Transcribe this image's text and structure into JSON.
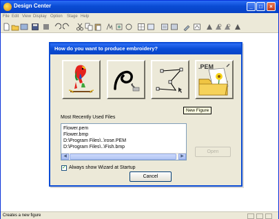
{
  "window": {
    "title": "Design Center",
    "controls": {
      "minimize": "_",
      "maximize": "□",
      "close": "×"
    }
  },
  "menubar": {
    "items": [
      "File",
      "Edit",
      "View",
      "Display",
      "Option",
      "Stage",
      "Help"
    ]
  },
  "toolbar": {
    "buttons": [
      "new-file-icon",
      "open-folder-icon",
      "import-icon",
      "save-icon",
      "undo-icon",
      "redo-icon",
      "cut-icon",
      "copy-icon",
      "paste-icon",
      "stage-icon",
      "image-icon",
      "rotate-icon",
      "grid-icon",
      "view-icon",
      "view-icon",
      "tool-icon",
      "tool-icon",
      "zoom-icon",
      "zoom-icon",
      "zoom-icon",
      "zoom-icon"
    ]
  },
  "wizard": {
    "title": "How do you want to produce embroidery?",
    "options": [
      "image-to-stitch-option",
      "manual-punch-option",
      "new-figure-option",
      "open-pem-option"
    ],
    "pem_label": ".PEM",
    "tooltip": "New Figure",
    "mru_label": "Most Recently Used Files",
    "mru_files": [
      "Flower.pem",
      "Flower.bmp",
      "D:\\Program Files\\..\\rose.PEM",
      "D:\\Program Files\\..\\Fish.bmp"
    ],
    "open_label": "Open",
    "checkbox_label": "Always show Wizard at Startup",
    "checkbox_checked": true,
    "cancel_label": "Cancel"
  },
  "statusbar": {
    "text": "Creates a new figure"
  },
  "colors": {
    "titlebar": "#0a4bd4",
    "dialog_bg": "#ece9d8",
    "tooltip_bg": "#ffffe1"
  }
}
